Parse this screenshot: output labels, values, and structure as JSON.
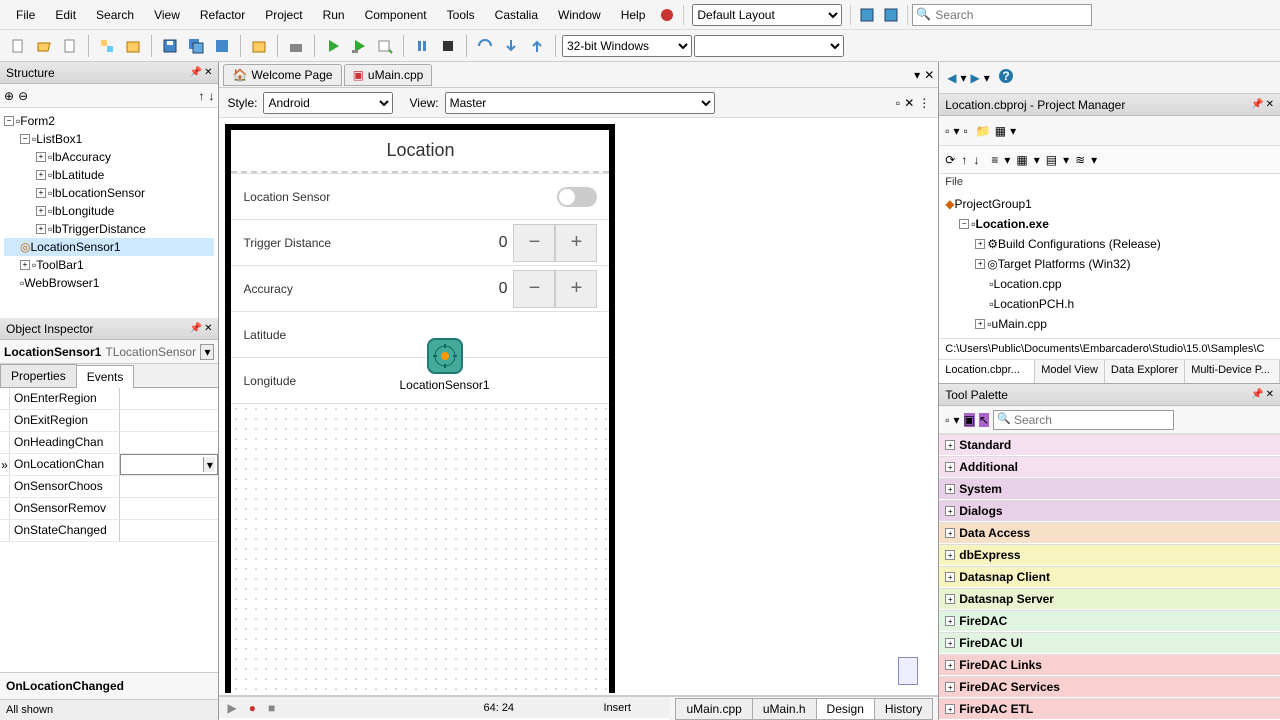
{
  "menu": [
    "File",
    "Edit",
    "Search",
    "View",
    "Refactor",
    "Project",
    "Run",
    "Component",
    "Tools",
    "Castalia",
    "Window",
    "Help"
  ],
  "layout_select": "Default Layout",
  "search_placeholder": "Search",
  "platform_select": "32-bit Windows",
  "structure": {
    "title": "Structure",
    "root": "Form2",
    "listbox": "ListBox1",
    "items": [
      "lbAccuracy",
      "lbLatitude",
      "lbLocationSensor",
      "lbLongitude",
      "lbTriggerDistance"
    ],
    "sensor": "LocationSensor1",
    "toolbar": "ToolBar1",
    "webbrowser": "WebBrowser1"
  },
  "inspector": {
    "title": "Object Inspector",
    "component": "LocationSensor1",
    "component_type": "TLocationSensor",
    "tab_properties": "Properties",
    "tab_events": "Events",
    "events": [
      "OnEnterRegion",
      "OnExitRegion",
      "OnHeadingChan",
      "OnLocationChan",
      "OnSensorChoos",
      "OnSensorRemov",
      "OnStateChanged"
    ],
    "selected_event_full": "OnLocationChanged",
    "all_shown": "All shown"
  },
  "editor": {
    "tabs": [
      "Welcome Page",
      "uMain.cpp"
    ],
    "style_label": "Style:",
    "style_value": "Android",
    "view_label": "View:",
    "view_value": "Master"
  },
  "mobile": {
    "title": "Location",
    "sensor_label": "Location Sensor",
    "trigger_label": "Trigger Distance",
    "trigger_value": "0",
    "accuracy_label": "Accuracy",
    "accuracy_value": "0",
    "lat_label": "Latitude",
    "lng_label": "Longitude",
    "sensor_widget": "LocationSensor1"
  },
  "bottom_tabs": [
    "uMain.cpp",
    "uMain.h",
    "Design",
    "History"
  ],
  "status": {
    "cursor": "64: 24",
    "mode": "Insert"
  },
  "pm": {
    "title": "Location.cbproj - Project Manager",
    "file_label": "File",
    "group": "ProjectGroup1",
    "exe": "Location.exe",
    "build": "Build Configurations (Release)",
    "target": "Target Platforms (Win32)",
    "files": [
      "Location.cpp",
      "LocationPCH.h",
      "uMain.cpp"
    ],
    "path": "C:\\Users\\Public\\Documents\\Embarcadero\\Studio\\15.0\\Samples\\C",
    "tabs": [
      "Location.cbpr...",
      "Model View",
      "Data Explorer",
      "Multi-Device P..."
    ]
  },
  "palette": {
    "title": "Tool Palette",
    "search_placeholder": "Search",
    "categories": [
      {
        "name": "Standard",
        "color": "#f5e0f0"
      },
      {
        "name": "Additional",
        "color": "#f5e0f0"
      },
      {
        "name": "System",
        "color": "#e8d0e8"
      },
      {
        "name": "Dialogs",
        "color": "#e8d0e8"
      },
      {
        "name": "Data Access",
        "color": "#f8e0c8"
      },
      {
        "name": "dbExpress",
        "color": "#f8f4c0"
      },
      {
        "name": "Datasnap Client",
        "color": "#f8f4c0"
      },
      {
        "name": "Datasnap Server",
        "color": "#e8f4d0"
      },
      {
        "name": "FireDAC",
        "color": "#e0f4e0"
      },
      {
        "name": "FireDAC UI",
        "color": "#e0f4e0"
      },
      {
        "name": "FireDAC Links",
        "color": "#f8d0d0"
      },
      {
        "name": "FireDAC Services",
        "color": "#f8d0d0"
      },
      {
        "name": "FireDAC ETL",
        "color": "#f8d0d0"
      }
    ]
  }
}
